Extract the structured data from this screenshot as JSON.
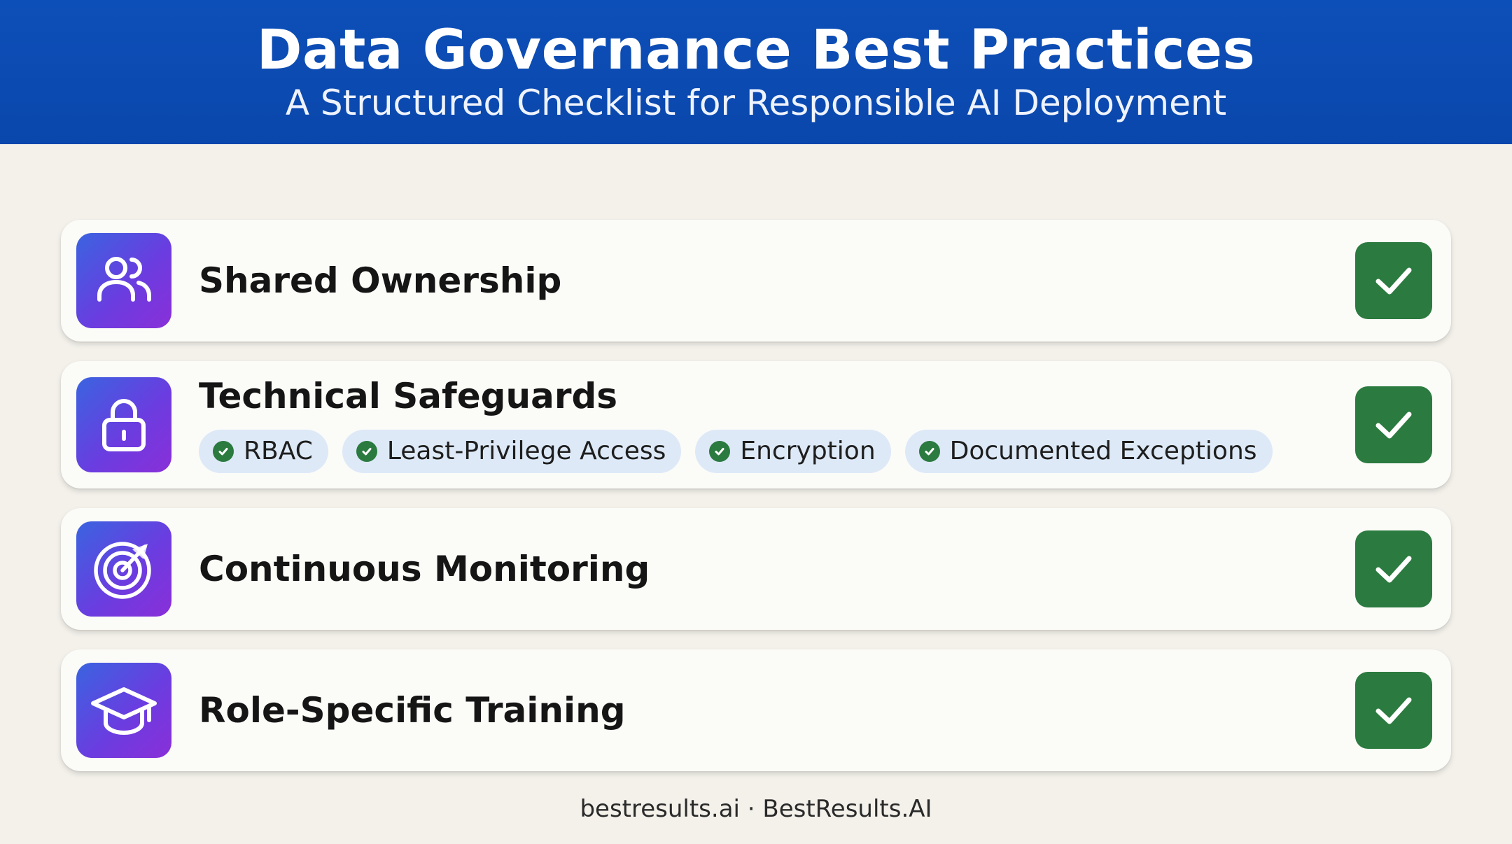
{
  "header": {
    "title": "Data Governance Best Practices",
    "subtitle": "A Structured Checklist for Responsible AI Deployment"
  },
  "colors": {
    "header_bg": "#0b4bb2",
    "check_green": "#2b7a3f",
    "icon_gradient_start": "#3a64e0",
    "icon_gradient_end": "#8a2fd8",
    "chip_bg": "#dde9f7"
  },
  "items": [
    {
      "title": "Shared Ownership",
      "icon": "users-icon",
      "checked": true
    },
    {
      "title": "Technical Safeguards",
      "icon": "lock-icon",
      "checked": true,
      "chips": [
        "RBAC",
        "Least-Privilege Access",
        "Encryption",
        "Documented Exceptions"
      ]
    },
    {
      "title": "Continuous Monitoring",
      "icon": "radar-icon",
      "checked": true
    },
    {
      "title": "Role-Specific Training",
      "icon": "graduation-cap-icon",
      "checked": true
    }
  ],
  "footer": {
    "text": "bestresults.ai · BestResults.AI"
  }
}
